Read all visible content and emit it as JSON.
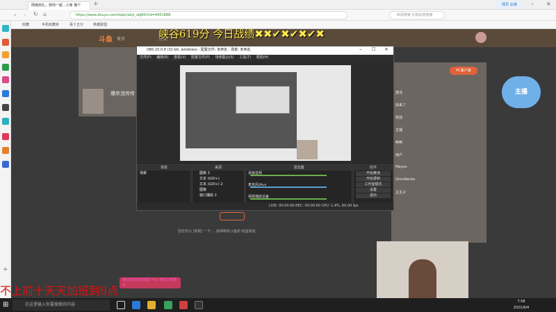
{
  "browser": {
    "tab_title": "网络商礼，熟你一起...小条 做个",
    "address_url": "https://www.douyu.com/topic/skyl_zbj80?rid=4451888",
    "search_placeholder": "新闻搜索 比较动态搜索"
  },
  "douyu": {
    "logo": "斗鱼",
    "nav_home": "首页",
    "nav_category": "分类",
    "streamer_name": "爆杀流传传",
    "report_note": "您还可以 [举报] 一下 ... 获得特有斗鱼的 权益体验",
    "bottom_note": "超过开始你的经验 可以 开始了解更多",
    "chat_list": [
      "激活",
      "快来了",
      "欢迎 ",
      "主播",
      "鸭鸭",
      "用户",
      "Mayon",
      "OmniRenta",
      "主主子"
    ],
    "pcbtn": "PC客户端"
  },
  "obs": {
    "title": "OBS 25.0.8 (32-bit, windows) - 配置文件: 未命名 - 场景: 未命名",
    "menu": [
      "文件(F)",
      "编辑(E)",
      "查看(V)",
      "配置文件(P)",
      "场景集合(S)",
      "工具(T)",
      "帮助(H)"
    ],
    "dock_scenes": "场景",
    "dock_sources": "来源",
    "dock_mixer": "混音器",
    "dock_transitions": "转场",
    "dock_controls": "控件",
    "scene_item": "场景",
    "sources": [
      "图像 3",
      "文本 (GDI+)",
      "文本 (GDI+) 2",
      "图像",
      "窗口捕获 2"
    ],
    "mixer_tracks": [
      "桌面音频",
      "麦克风/Aux",
      "视频捕获设备"
    ],
    "controls": [
      "开始推流",
      "开始录制",
      "工作室模式",
      "设置",
      "退出"
    ],
    "status": "LIVE: 00:00:00   REC: 00:00:00   CPU: 1.4%, 60.00 fps"
  },
  "overlay": {
    "top_banner": "峡谷619分 今日战绩✖✖✔✖✔✖✔✖",
    "bottom_banner": "不上前十天天加班到8点",
    "mascot": "主播"
  },
  "taskbar": {
    "search_text": "在这里输入你要搜索的内容",
    "time": "7:58",
    "date": "2021/6/4"
  }
}
